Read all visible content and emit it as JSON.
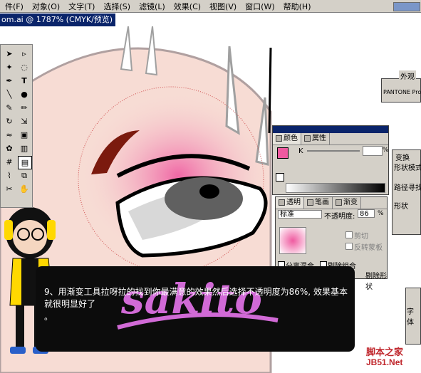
{
  "menubar": {
    "items": [
      "件(F)",
      "对象(O)",
      "文字(T)",
      "选择(S)",
      "滤镜(L)",
      "效果(C)",
      "视图(V)",
      "窗口(W)",
      "帮助(H)"
    ]
  },
  "document": {
    "title": "om.ai @ 1787% (CMYK/预览)"
  },
  "toolbox": {
    "tools": [
      "arrow",
      "direct-select",
      "magic-wand",
      "lasso",
      "pen",
      "type",
      "line",
      "ellipse",
      "brush",
      "pencil",
      "rotate",
      "scale",
      "warp",
      "free-transform",
      "symbol",
      "graph",
      "mesh",
      "gradient",
      "eyedropper",
      "blend",
      "scissors",
      "hand",
      "zoom"
    ]
  },
  "color_panel": {
    "tabs": [
      "颜色",
      "属性"
    ],
    "k_label": "K",
    "percent": "%"
  },
  "transparency_panel": {
    "tabs": [
      "透明",
      "笔画",
      "渐变"
    ],
    "blend_mode": "标准",
    "opacity_label": "不透明度:",
    "opacity_value": "86",
    "percent": "%",
    "clip_label": "剪切",
    "invert_mask_label": "反转蒙板",
    "isolate_blending_label": "分离混合",
    "knockout_group_label": "剔除组合",
    "shape_knockout_label": "剔除形状"
  },
  "side_panels": {
    "appearance_tab": "外观",
    "pantone_label": "PANTONE Pro",
    "transform_tab": "变换",
    "shape_mode_label": "形状模式",
    "pathfinder_label": "路径寻找",
    "shape_label": "形状",
    "character_label": "字体"
  },
  "tutorial": {
    "step": "9、用渐变工具拉呀拉的找到你最满意的效果然后选择不透明度为86%, 效果基本就很明显好了",
    "dot": "。",
    "logo_text": "sakito"
  },
  "watermark": {
    "line1": "脚本之家",
    "line2": "JB51.Net"
  },
  "colors": {
    "menubar": "#d4d0c8",
    "titlebar": "#0a246a",
    "skin": "#f7dcd4",
    "pink_gradient": "#ef5aa0",
    "logo_pink": "#d16ad6",
    "overlay": "#0c0c0c",
    "watermark": "#c0272d"
  }
}
